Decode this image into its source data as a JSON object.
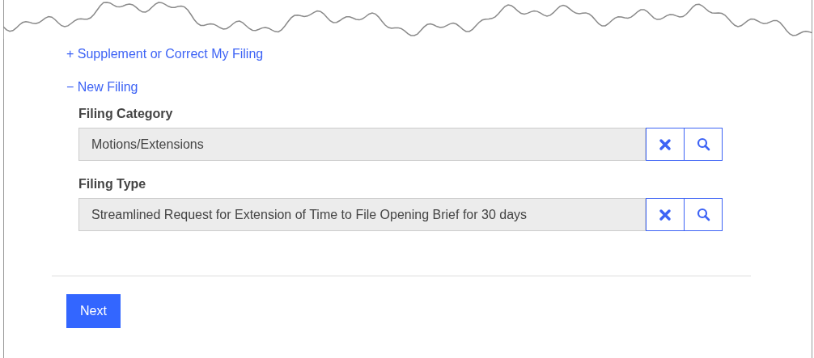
{
  "links": [
    {
      "label": "+ Supplement or Correct My Filing"
    },
    {
      "label": "− New Filing"
    }
  ],
  "fields": [
    {
      "label": "Filing Category",
      "value": "Motions/Extensions"
    },
    {
      "label": "Filing Type",
      "value": "Streamlined Request for Extension of Time to File Opening Brief for 30 days"
    }
  ],
  "buttons": [
    "Next"
  ]
}
